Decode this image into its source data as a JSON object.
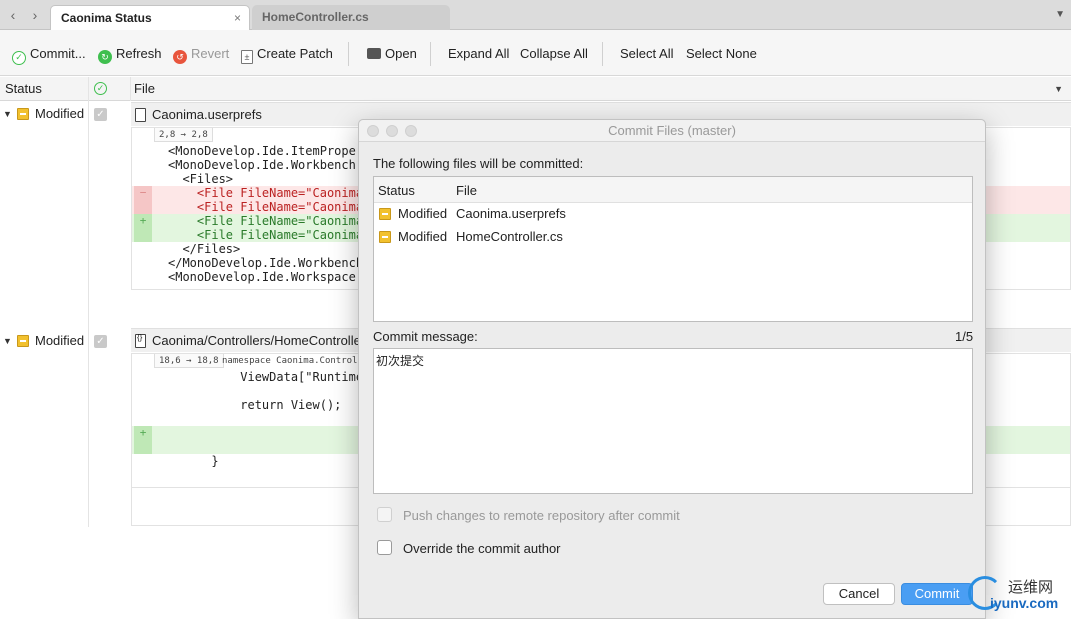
{
  "tabs": {
    "back": "‹",
    "forward": "›",
    "active": "Caonima Status",
    "inactive": "HomeController.cs",
    "close": "×",
    "menu": "▼"
  },
  "toolbar": {
    "commit": "Commit...",
    "refresh": "Refresh",
    "revert": "Revert",
    "create_patch": "Create Patch",
    "open": "Open",
    "expand_all": "Expand All",
    "collapse_all": "Collapse All",
    "select_all": "Select All",
    "select_none": "Select None"
  },
  "columns": {
    "status": "Status",
    "file": "File",
    "menu": "▼"
  },
  "files": [
    {
      "status": "Modified",
      "name": "Caonima.userprefs",
      "hunk": "2,8 → 2,8",
      "hunk_context": "",
      "lines": [
        {
          "type": "ctx",
          "gut": "",
          "text": "<MonoDevelop.Ide.ItemProper"
        },
        {
          "type": "ctx",
          "gut": "",
          "text": "<MonoDevelop.Ide.Workbench"
        },
        {
          "type": "ctx",
          "gut": "",
          "text": "  <Files>"
        },
        {
          "type": "del",
          "gut": "−",
          "text": "    <File FileName=\"Caonima"
        },
        {
          "type": "del",
          "gut": "",
          "text": "    <File FileName=\"Caonima"
        },
        {
          "type": "add",
          "gut": "+",
          "text": "    <File FileName=\"Caonima"
        },
        {
          "type": "add",
          "gut": "",
          "text": "    <File FileName=\"Caonima"
        },
        {
          "type": "ctx",
          "gut": "",
          "text": "  </Files>"
        },
        {
          "type": "ctx",
          "gut": "",
          "text": "</MonoDevelop.Ide.Workbench"
        },
        {
          "type": "ctx",
          "gut": "",
          "text": "<MonoDevelop.Ide.Workspace"
        }
      ]
    },
    {
      "status": "Modified",
      "name": "Caonima/Controllers/HomeController.cs",
      "hunk": "18,6 → 18,8",
      "hunk_context": "namespace Caonima.Controlle",
      "lines": [
        {
          "type": "ctx",
          "gut": "",
          "text": "          ViewData[\"Runtime"
        },
        {
          "type": "ctx",
          "gut": "",
          "text": ""
        },
        {
          "type": "ctx",
          "gut": "",
          "text": "          return View();"
        },
        {
          "type": "ctx",
          "gut": "",
          "text": ""
        },
        {
          "type": "add",
          "gut": "+",
          "text": ""
        },
        {
          "type": "add",
          "gut": "",
          "text": ""
        },
        {
          "type": "ctx",
          "gut": "",
          "text": "      }"
        }
      ]
    }
  ],
  "dialog": {
    "title": "Commit Files (master)",
    "files_label": "The following files will be committed:",
    "table_status": "Status",
    "table_file": "File",
    "rows": [
      {
        "status": "Modified",
        "file": "Caonima.userprefs"
      },
      {
        "status": "Modified",
        "file": "HomeController.cs"
      }
    ],
    "message_label": "Commit message:",
    "message_counter": "1/5",
    "message": "初次提交",
    "push_label": "Push changes to remote repository after commit",
    "override_label": "Override the commit author",
    "cancel": "Cancel",
    "commit": "Commit"
  },
  "watermark": {
    "cn": "运维网",
    "en": "iyunv.com"
  },
  "colors": {
    "accent": "#4a9ef3",
    "modified": "#f2c12e",
    "refresh": "#3fbf4f",
    "revert": "#e8553d"
  }
}
